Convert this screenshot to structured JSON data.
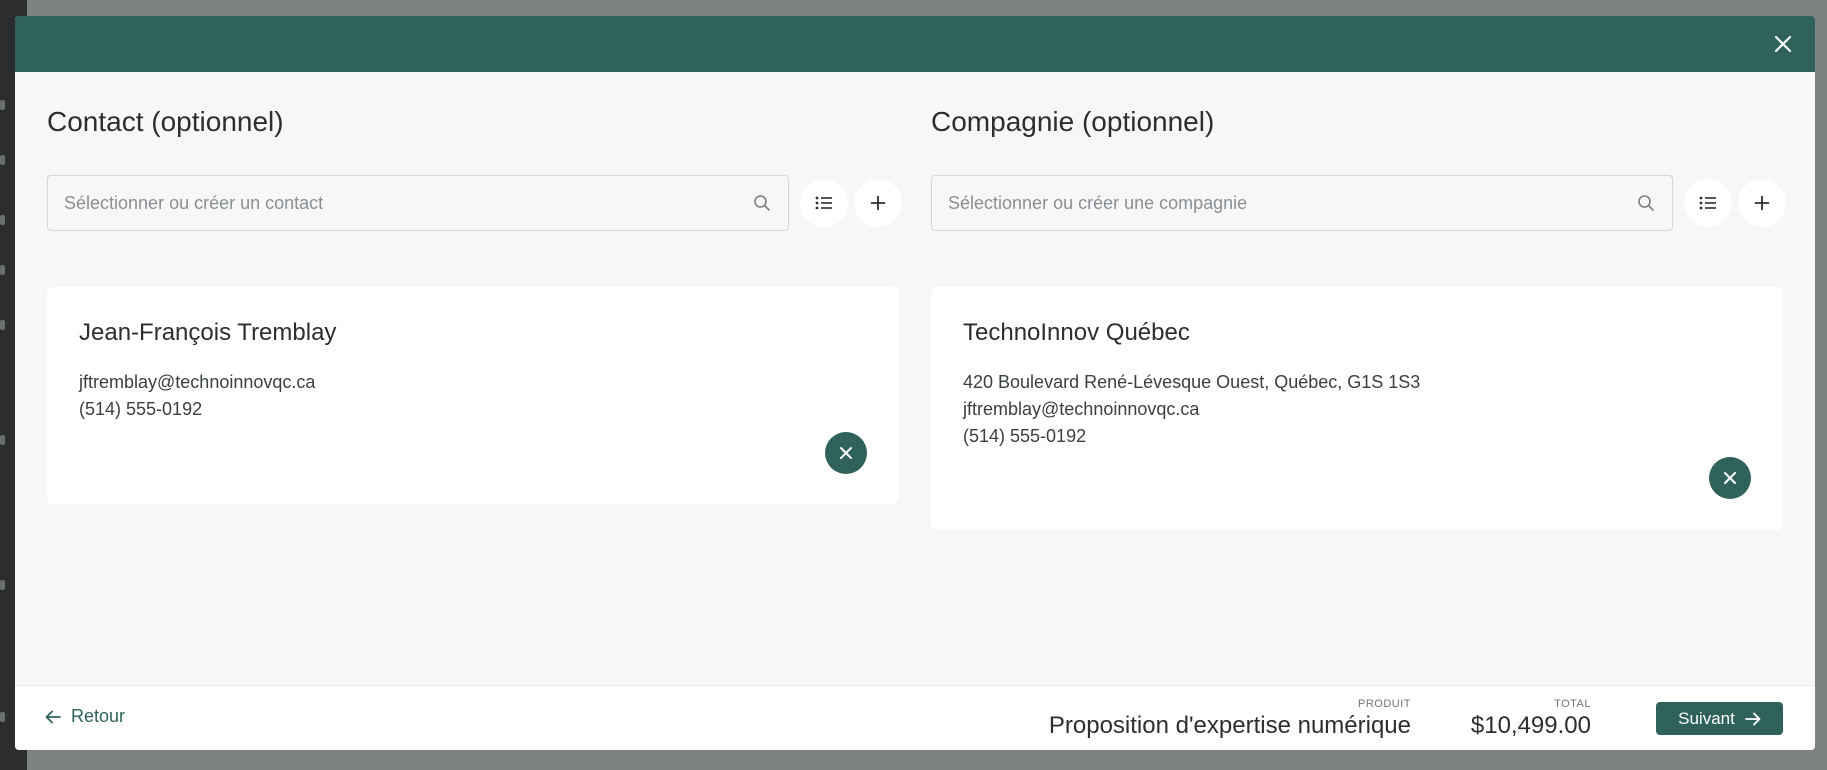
{
  "contact": {
    "title": "Contact (optionnel)",
    "search_placeholder": "Sélectionner ou créer un contact",
    "search_value": "",
    "card": {
      "name": "Jean-François Tremblay",
      "email": "jftremblay@technoinnovqc.ca",
      "phone": "(514) 555-0192"
    }
  },
  "company": {
    "title": "Compagnie (optionnel)",
    "search_placeholder": "Sélectionner ou créer une compagnie",
    "search_value": "",
    "card": {
      "name": "TechnoInnov Québec",
      "address": "420 Boulevard René-Lévesque Ouest, Québec, G1S 1S3",
      "email": "jftremblay@technoinnovqc.ca",
      "phone": "(514) 555-0192"
    }
  },
  "footer": {
    "back_label": "Retour",
    "product_label": "PRODUIT",
    "product_value": "Proposition d'expertise numérique",
    "total_label": "TOTAL",
    "total_value": "$10,499.00",
    "next_label": "Suivant"
  },
  "icons": {
    "close": "close-icon",
    "search": "search-icon",
    "list": "list-icon",
    "add": "plus-icon",
    "remove": "close-icon",
    "back": "arrow-left-icon",
    "next": "arrow-right-icon"
  },
  "colors": {
    "brand": "#2f625b",
    "modal_bg": "#f7f7f7",
    "card_bg": "#ffffff",
    "overlay": "#7e8281"
  }
}
